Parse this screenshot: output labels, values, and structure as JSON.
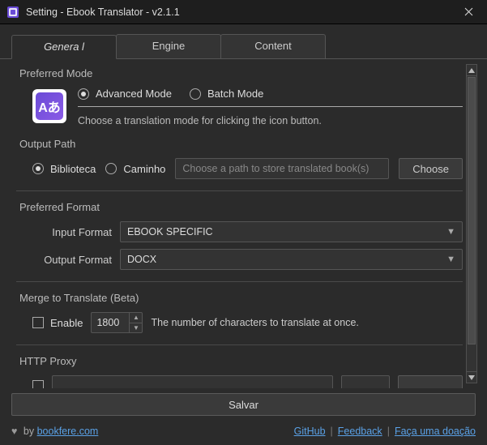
{
  "window": {
    "title": "Setting - Ebook Translator - v2.1.1"
  },
  "tabs": {
    "general": "Genera l",
    "engine": "Engine",
    "content": "Content",
    "active": 0
  },
  "preferred_mode": {
    "title": "Preferred Mode",
    "advanced": "Advanced Mode",
    "batch": "Batch Mode",
    "selected": "advanced",
    "description": "Choose a translation mode for clicking the icon button.",
    "icon_glyph": "Aあ"
  },
  "output_path": {
    "title": "Output Path",
    "library": "Biblioteca",
    "path": "Caminho",
    "selected": "library",
    "placeholder": "Choose a path to store translated book(s)",
    "choose": "Choose"
  },
  "format": {
    "title": "Preferred Format",
    "input_label": "Input Format",
    "input_value": "EBOOK SPECIFIC",
    "output_label": "Output Format",
    "output_value": "DOCX"
  },
  "merge": {
    "title": "Merge to Translate (Beta)",
    "enable": "Enable",
    "value": "1800",
    "hint": "The number of characters to translate at once."
  },
  "proxy": {
    "title": "HTTP Proxy"
  },
  "save_label": "Salvar",
  "footer": {
    "by_prefix": "by ",
    "author": "bookfere.com",
    "github": "GitHub",
    "feedback": "Feedback",
    "donate": "Faça uma doação"
  }
}
